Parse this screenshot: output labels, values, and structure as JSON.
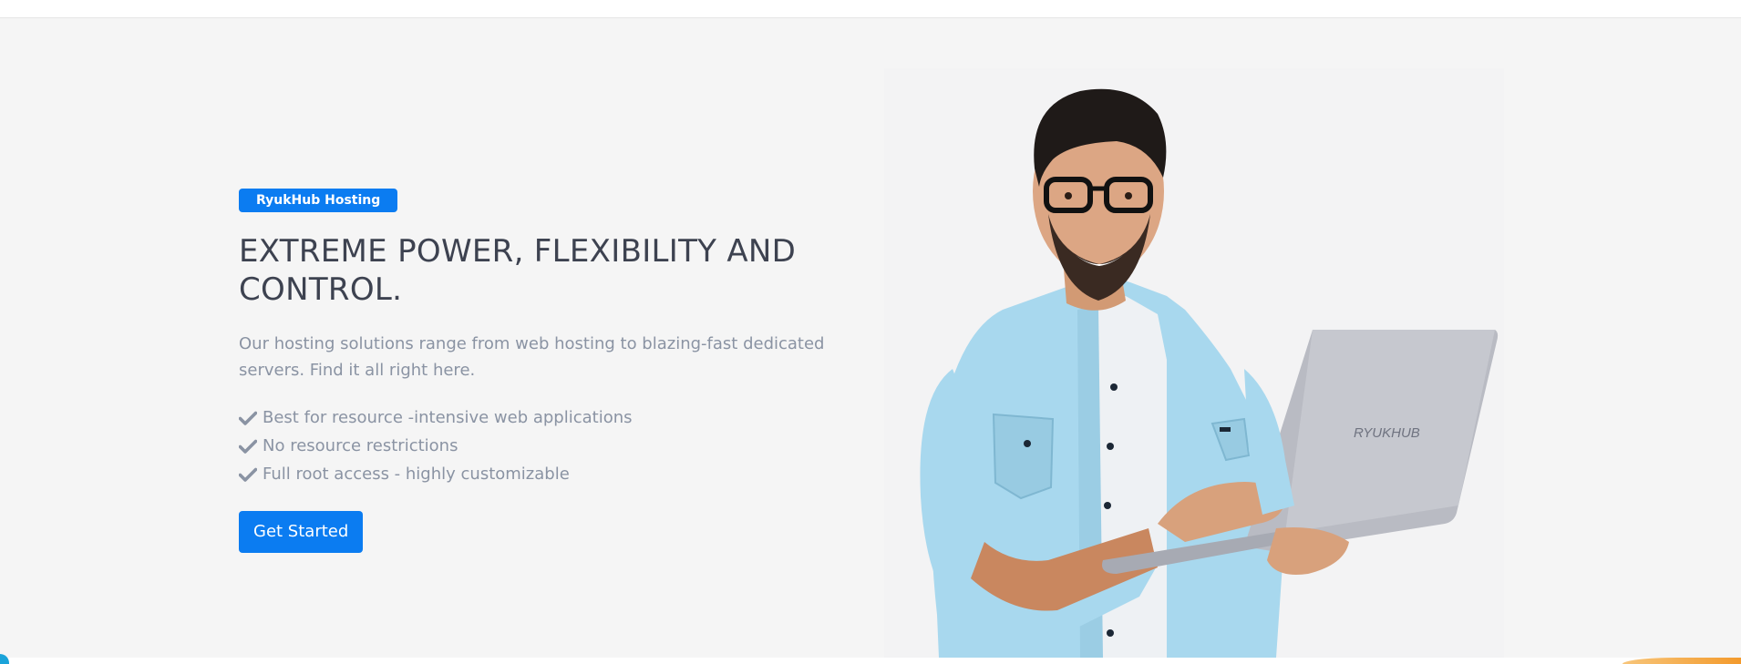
{
  "hero": {
    "badge": "RyukHub Hosting",
    "headline": "EXTREME POWER, FLEXIBILITY AND CONTROL.",
    "description": "Our hosting solutions range from web hosting to blazing-fast dedicated servers. Find it all right here.",
    "features": [
      "Best for resource -intensive web applications",
      "No resource restrictions",
      "Full root access - highly customizable"
    ],
    "cta_label": "Get Started",
    "laptop_logo": "RYUKHUB"
  },
  "colors": {
    "accent": "#0b7cf1",
    "heading": "#3d4250",
    "muted": "#8a93a3",
    "hero_background": "#f5f5f5"
  },
  "icons": {
    "feature_bullet": "check-icon"
  }
}
